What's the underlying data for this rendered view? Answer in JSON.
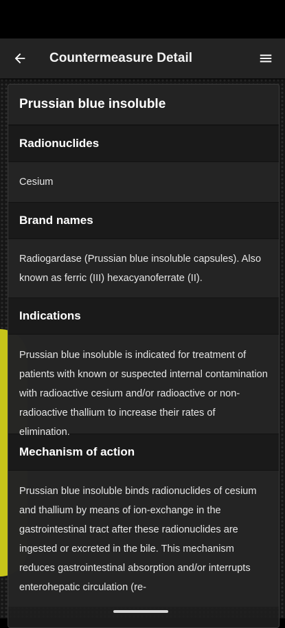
{
  "app_bar": {
    "title": "Countermeasure Detail",
    "back_icon": "arrow-left-icon",
    "menu_icon": "hamburger-menu-icon"
  },
  "countermeasure": {
    "name": "Prussian blue insoluble",
    "sections": [
      {
        "heading": "Radionuclides",
        "body": "Cesium"
      },
      {
        "heading": "Brand names",
        "body": "Radiogardase (Prussian blue insoluble capsules). Also known as ferric (III) hexacyanoferrate (II)."
      },
      {
        "heading": "Indications",
        "body": "Prussian blue insoluble is indicated for treatment of patients with known or suspected internal contamination with radioactive cesium and/or radioactive or non-radioactive thallium to increase their rates of elimination."
      },
      {
        "heading": "Mechanism of action",
        "body": "Prussian blue insoluble binds radionuclides of cesium and thallium by means of ion-exchange in the gastrointestinal tract after these radionuclides are ingested or excreted in the bile. This mechanism reduces gastrointestinal absorption and/or interrupts enterohepatic circulation (re-"
      }
    ]
  },
  "colors": {
    "app_bar": "#232323",
    "card": "#1e1e1e",
    "hazard_accent": "#c7c41a"
  }
}
